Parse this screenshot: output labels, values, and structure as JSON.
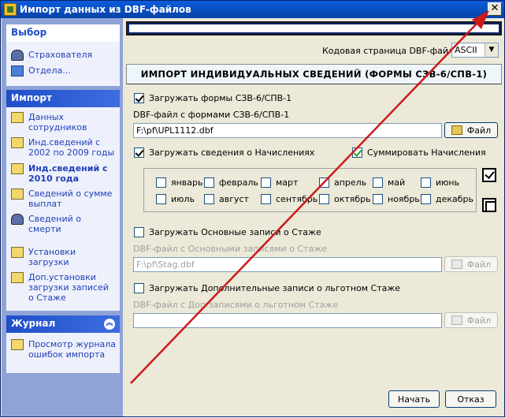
{
  "window": {
    "title": "Импорт данных из DBF-файлов",
    "close": "✕"
  },
  "sidebar": {
    "select_panel": {
      "title": "Выбор",
      "items": [
        "Страхователя",
        "Отдела..."
      ]
    },
    "import_panel": {
      "title": "Импорт",
      "items": [
        {
          "label": "Данных сотрудников",
          "bold": false
        },
        {
          "label": "Инд.сведений с 2002 по 2009 годы",
          "bold": false
        },
        {
          "label": "Инд.сведений с 2010 года",
          "bold": true
        },
        {
          "label": "Сведений о сумме выплат",
          "bold": false
        },
        {
          "label": "Сведений о смерти",
          "bold": false
        },
        {
          "label": "Установки загрузки",
          "bold": false
        },
        {
          "label": "Доп.установки загрузки записей о Стаже",
          "bold": false
        }
      ]
    },
    "journal_panel": {
      "title": "Журнал",
      "collapse": "︽",
      "items": [
        "Просмотр журнала ошибок импорта"
      ]
    }
  },
  "main": {
    "codepage_label": "Кодовая страница DBF-файлов:",
    "codepage_value": "ASCII",
    "dropdown_arrow": "▼",
    "header": "ИМПОРТ ИНДИВИДУАЛЬНЫХ СВЕДЕНИЙ (ФОРМЫ СЗВ-6/СПВ-1)",
    "load_forms": {
      "label": "Загружать формы СЗВ-6/СПВ-1",
      "checked": true
    },
    "forms_file_label": "DBF-файл с формами СЗВ-6/СПВ-1",
    "forms_file_value": "F:\\pf\\UPL1112.dbf",
    "file_button": "Файл",
    "load_accruals": {
      "label": "Загружать сведения о Начислениях",
      "checked": true
    },
    "sum_accruals": {
      "label": "Суммировать Начисления",
      "checked": true
    },
    "months": [
      "январь",
      "февраль",
      "март",
      "апрель",
      "май",
      "июнь",
      "июль",
      "август",
      "сентябрь",
      "октябрь",
      "ноябрь",
      "декабрь"
    ],
    "load_main_stazh": {
      "label": "Загружать Основные записи о Стаже",
      "checked": false
    },
    "main_stazh_file_label": "DBF-файл с Основными записями о Стаже",
    "main_stazh_file_value": "F:\\pf\\Stag.dbf",
    "load_extra_stazh": {
      "label": "Загружать Дополнительные записи о льготном Стаже",
      "checked": false
    },
    "extra_stazh_file_label": "DBF-файл с Доп.записями о льготном Стаже",
    "extra_stazh_file_value": "",
    "start_button": "Начать",
    "cancel_button": "Отказ"
  },
  "colors": {
    "title_bar": "#0a5ddc",
    "sidebar_bg": "#8fa3d6",
    "link": "#1f3fb8",
    "arrow": "#cc1a1a"
  }
}
